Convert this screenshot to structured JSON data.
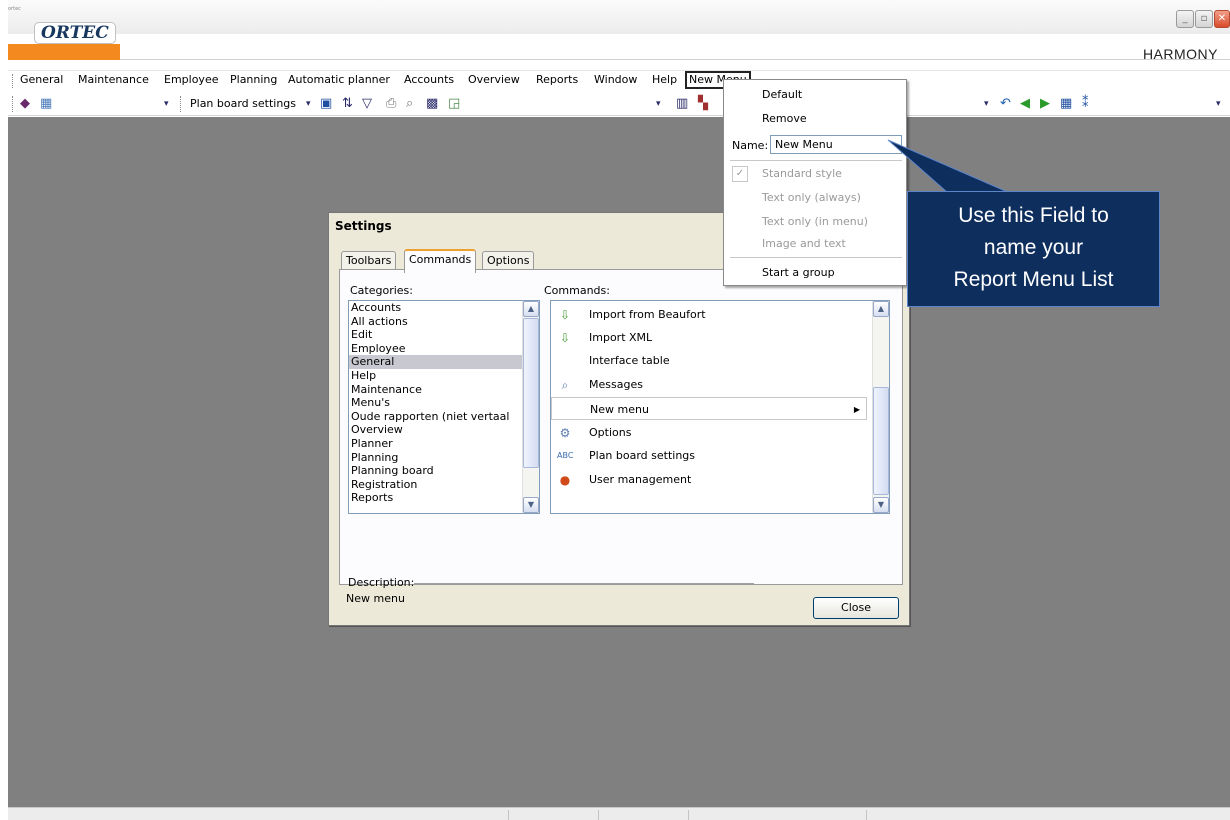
{
  "app": {
    "logo_small": "ortec",
    "logo": "ORTEC",
    "brand": "HARMONY",
    "window_buttons": {
      "minimize": "_",
      "maximize": "▫",
      "close": "✕"
    }
  },
  "menubar": {
    "items": [
      "General",
      "Maintenance",
      "Employee",
      "Planning",
      "Automatic planner",
      "Accounts",
      "Overview",
      "Reports",
      "Window",
      "Help"
    ],
    "new_menu": "New Menu"
  },
  "toolbar": {
    "plan_board_settings": "Plan board settings",
    "dropdown_arrow": "▾"
  },
  "context_menu": {
    "default": "Default",
    "remove": "Remove",
    "name_label": "Name:",
    "name_value": "New Menu",
    "standard_style": "Standard style",
    "text_only_always": "Text only (always)",
    "text_only_in_menu": "Text only (in menu)",
    "image_and_text": "Image and text",
    "start_group": "Start a group"
  },
  "settings": {
    "title": "Settings",
    "tabs": [
      "Toolbars",
      "Commands",
      "Options"
    ],
    "active_tab": "Commands",
    "categories_label": "Categories:",
    "categories": [
      "Accounts",
      "All actions",
      "Edit",
      "Employee",
      "General",
      "Help",
      "Maintenance",
      "Menu's",
      "Oude rapporten (niet vertaal",
      "Overview",
      "Planner",
      "Planning",
      "Planning board",
      "Registration",
      "Reports"
    ],
    "selected_category": "General",
    "commands_label": "Commands:",
    "commands": [
      {
        "label": "Import from Beaufort",
        "icon": "import-icon"
      },
      {
        "label": "Import XML",
        "icon": "import-xml-icon"
      },
      {
        "label": "Interface table",
        "icon": ""
      },
      {
        "label": "Messages",
        "icon": "messages-icon"
      },
      {
        "label": "New menu",
        "icon": ""
      },
      {
        "label": "Options",
        "icon": "options-icon"
      },
      {
        "label": "Plan board settings",
        "icon": "plan-board-settings-icon"
      },
      {
        "label": "User management",
        "icon": "user-icon"
      }
    ],
    "description_label": "Description:",
    "description_value": "New menu",
    "close_label": "Close"
  },
  "callout": {
    "line1": "Use this Field to",
    "line2": "name your",
    "line3": "Report Menu List",
    "color": "#0e2e5e"
  }
}
